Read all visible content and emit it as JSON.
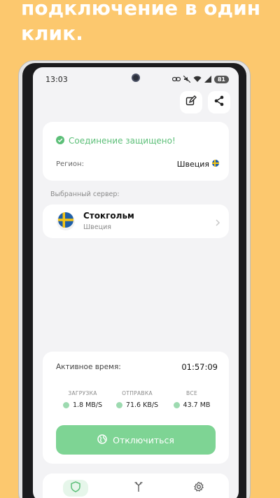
{
  "promo": {
    "headline": "подключение в один клик."
  },
  "statusbar": {
    "time": "13:03",
    "battery": "81"
  },
  "status_card": {
    "secure_text": "Соединение защищено!",
    "region_label": "Регион:",
    "region_value": "Швеция"
  },
  "server_section": {
    "label": "Выбранный сервер:",
    "server_name": "Стокгольм",
    "server_country": "Швеция"
  },
  "stats": {
    "active_time_label": "Активное время:",
    "active_time_value": "01:57:09",
    "download_label": "ЗАГРУЗКА",
    "download_value": "1.8 MB/S",
    "upload_label": "ОТПРАВКА",
    "upload_value": "71.6 KB/S",
    "total_label": "ВСЕ",
    "total_value": "43.7 MB",
    "disconnect_label": "Отключиться"
  },
  "colors": {
    "background": "#fcc86e",
    "accent_green": "#7ed494",
    "secure_green": "#5cbf78"
  },
  "icons": {
    "top_actions": [
      "edit-icon",
      "share-icon"
    ],
    "tabs": [
      "shield-icon",
      "routes-icon",
      "settings-gear-icon"
    ]
  }
}
